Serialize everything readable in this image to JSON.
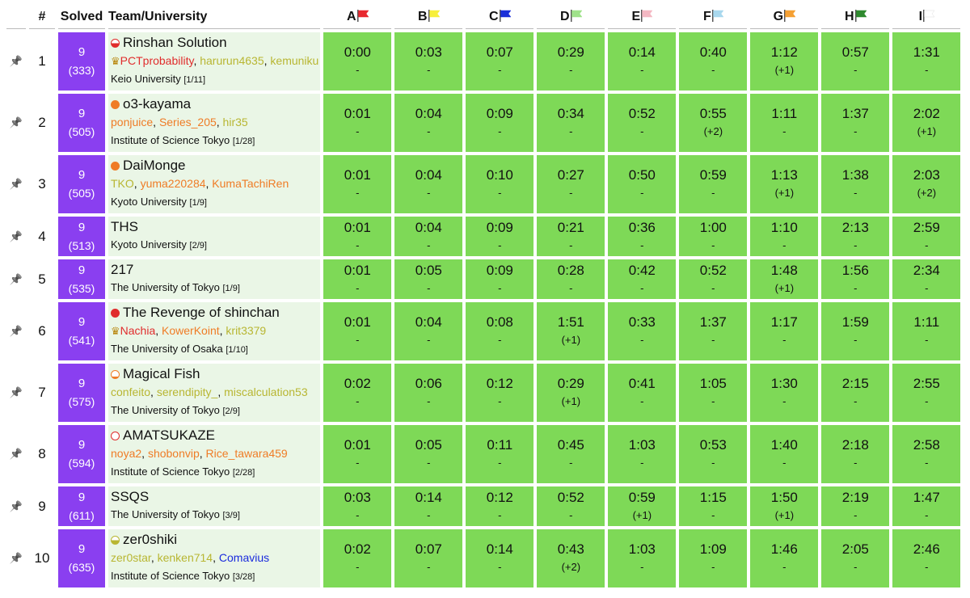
{
  "headers": {
    "rank": "#",
    "solved": "Solved",
    "team": "Team/University"
  },
  "problems": [
    {
      "letter": "A",
      "flag_color": "#e8292f"
    },
    {
      "letter": "B",
      "flag_color": "#f7ef3a"
    },
    {
      "letter": "C",
      "flag_color": "#1a2fd8"
    },
    {
      "letter": "D",
      "flag_color": "#9fe28a"
    },
    {
      "letter": "E",
      "flag_color": "#f4b8c3"
    },
    {
      "letter": "F",
      "flag_color": "#a9d8ee"
    },
    {
      "letter": "G",
      "flag_color": "#f5a033"
    },
    {
      "letter": "H",
      "flag_color": "#2f8a2f"
    },
    {
      "letter": "I",
      "flag_color": "#ffffff"
    }
  ],
  "colors": {
    "solved_bg": "#8a3ff0",
    "ac_bg": "#7ed957",
    "team_bg": "#eaf6e6",
    "red": "#e02c2c",
    "orange": "#ef7c26",
    "yellow": "#b8b632",
    "blue": "#1b2bdd"
  },
  "rows": [
    {
      "rank": "1",
      "solved": "9",
      "penalty": "(333)",
      "name": "Rinshan Solution",
      "dot": "red-half",
      "members": [
        {
          "name": "PCTprobability",
          "color": "#e02c2c",
          "crown": true
        },
        {
          "name": "harurun4635",
          "color": "#b8b632"
        },
        {
          "name": "kemuniku",
          "color": "#b8b632"
        }
      ],
      "university": "Keio University",
      "uni_rank": "[1/11]",
      "cells": [
        [
          "0:00",
          "-"
        ],
        [
          "0:03",
          "-"
        ],
        [
          "0:07",
          "-"
        ],
        [
          "0:29",
          "-"
        ],
        [
          "0:14",
          "-"
        ],
        [
          "0:40",
          "-"
        ],
        [
          "1:12",
          "(+1)"
        ],
        [
          "0:57",
          "-"
        ],
        [
          "1:31",
          "-"
        ]
      ]
    },
    {
      "rank": "2",
      "solved": "9",
      "penalty": "(505)",
      "name": "o3-kayama",
      "dot": "orange-full",
      "members": [
        {
          "name": "ponjuice",
          "color": "#ef7c26"
        },
        {
          "name": "Series_205",
          "color": "#ef7c26"
        },
        {
          "name": "hir35",
          "color": "#b8b632"
        }
      ],
      "university": "Institute of Science Tokyo",
      "uni_rank": "[1/28]",
      "cells": [
        [
          "0:01",
          "-"
        ],
        [
          "0:04",
          "-"
        ],
        [
          "0:09",
          "-"
        ],
        [
          "0:34",
          "-"
        ],
        [
          "0:52",
          "-"
        ],
        [
          "0:55",
          "(+2)"
        ],
        [
          "1:11",
          "-"
        ],
        [
          "1:37",
          "-"
        ],
        [
          "2:02",
          "(+1)"
        ]
      ]
    },
    {
      "rank": "3",
      "solved": "9",
      "penalty": "(505)",
      "name": "DaiMonge",
      "dot": "orange-full",
      "members": [
        {
          "name": "TKO",
          "color": "#b8b632"
        },
        {
          "name": "yuma220284",
          "color": "#ef7c26"
        },
        {
          "name": "KumaTachiRen",
          "color": "#ef7c26"
        }
      ],
      "university": "Kyoto University",
      "uni_rank": "[1/9]",
      "cells": [
        [
          "0:01",
          "-"
        ],
        [
          "0:04",
          "-"
        ],
        [
          "0:10",
          "-"
        ],
        [
          "0:27",
          "-"
        ],
        [
          "0:50",
          "-"
        ],
        [
          "0:59",
          "-"
        ],
        [
          "1:13",
          "(+1)"
        ],
        [
          "1:38",
          "-"
        ],
        [
          "2:03",
          "(+2)"
        ]
      ]
    },
    {
      "rank": "4",
      "solved": "9",
      "penalty": "(513)",
      "name": "THS",
      "dot": "",
      "members": [],
      "university": "Kyoto University",
      "uni_rank": "[2/9]",
      "cells": [
        [
          "0:01",
          "-"
        ],
        [
          "0:04",
          "-"
        ],
        [
          "0:09",
          "-"
        ],
        [
          "0:21",
          "-"
        ],
        [
          "0:36",
          "-"
        ],
        [
          "1:00",
          "-"
        ],
        [
          "1:10",
          "-"
        ],
        [
          "2:13",
          "-"
        ],
        [
          "2:59",
          "-"
        ]
      ]
    },
    {
      "rank": "5",
      "solved": "9",
      "penalty": "(535)",
      "name": "217",
      "dot": "",
      "members": [],
      "university": "The University of Tokyo",
      "uni_rank": "[1/9]",
      "cells": [
        [
          "0:01",
          "-"
        ],
        [
          "0:05",
          "-"
        ],
        [
          "0:09",
          "-"
        ],
        [
          "0:28",
          "-"
        ],
        [
          "0:42",
          "-"
        ],
        [
          "0:52",
          "-"
        ],
        [
          "1:48",
          "(+1)"
        ],
        [
          "1:56",
          "-"
        ],
        [
          "2:34",
          "-"
        ]
      ]
    },
    {
      "rank": "6",
      "solved": "9",
      "penalty": "(541)",
      "name": "The Revenge of shinchan",
      "dot": "red-full",
      "members": [
        {
          "name": "Nachia",
          "color": "#e02c2c",
          "crown": true
        },
        {
          "name": "KowerKoint",
          "color": "#ef7c26"
        },
        {
          "name": "krit3379",
          "color": "#b8b632"
        }
      ],
      "university": "The University of Osaka",
      "uni_rank": "[1/10]",
      "cells": [
        [
          "0:01",
          "-"
        ],
        [
          "0:04",
          "-"
        ],
        [
          "0:08",
          "-"
        ],
        [
          "1:51",
          "(+1)"
        ],
        [
          "0:33",
          "-"
        ],
        [
          "1:37",
          "-"
        ],
        [
          "1:17",
          "-"
        ],
        [
          "1:59",
          "-"
        ],
        [
          "1:11",
          "-"
        ]
      ]
    },
    {
      "rank": "7",
      "solved": "9",
      "penalty": "(575)",
      "name": "Magical Fish",
      "dot": "orange-low",
      "members": [
        {
          "name": "confeito",
          "color": "#b8b632"
        },
        {
          "name": "serendipity_",
          "color": "#b8b632"
        },
        {
          "name": "miscalculation53",
          "color": "#b8b632"
        }
      ],
      "university": "The University of Tokyo",
      "uni_rank": "[2/9]",
      "cells": [
        [
          "0:02",
          "-"
        ],
        [
          "0:06",
          "-"
        ],
        [
          "0:12",
          "-"
        ],
        [
          "0:29",
          "(+1)"
        ],
        [
          "0:41",
          "-"
        ],
        [
          "1:05",
          "-"
        ],
        [
          "1:30",
          "-"
        ],
        [
          "2:15",
          "-"
        ],
        [
          "2:55",
          "-"
        ]
      ]
    },
    {
      "rank": "8",
      "solved": "9",
      "penalty": "(594)",
      "name": "AMATSUKAZE",
      "dot": "red-empty",
      "members": [
        {
          "name": "noya2",
          "color": "#ef7c26"
        },
        {
          "name": "shobonvip",
          "color": "#ef7c26"
        },
        {
          "name": "Rice_tawara459",
          "color": "#ef7c26"
        }
      ],
      "university": "Institute of Science Tokyo",
      "uni_rank": "[2/28]",
      "cells": [
        [
          "0:01",
          "-"
        ],
        [
          "0:05",
          "-"
        ],
        [
          "0:11",
          "-"
        ],
        [
          "0:45",
          "-"
        ],
        [
          "1:03",
          "-"
        ],
        [
          "0:53",
          "-"
        ],
        [
          "1:40",
          "-"
        ],
        [
          "2:18",
          "-"
        ],
        [
          "2:58",
          "-"
        ]
      ]
    },
    {
      "rank": "9",
      "solved": "9",
      "penalty": "(611)",
      "name": "SSQS",
      "dot": "",
      "members": [],
      "university": "The University of Tokyo",
      "uni_rank": "[3/9]",
      "cells": [
        [
          "0:03",
          "-"
        ],
        [
          "0:14",
          "-"
        ],
        [
          "0:12",
          "-"
        ],
        [
          "0:52",
          "-"
        ],
        [
          "0:59",
          "(+1)"
        ],
        [
          "1:15",
          "-"
        ],
        [
          "1:50",
          "(+1)"
        ],
        [
          "2:19",
          "-"
        ],
        [
          "1:47",
          "-"
        ]
      ]
    },
    {
      "rank": "10",
      "solved": "9",
      "penalty": "(635)",
      "name": "zer0shiki",
      "dot": "yellow-half",
      "members": [
        {
          "name": "zer0star",
          "color": "#b8b632"
        },
        {
          "name": "kenken714",
          "color": "#b8b632"
        },
        {
          "name": "Comavius",
          "color": "#1b2bdd"
        }
      ],
      "university": "Institute of Science Tokyo",
      "uni_rank": "[3/28]",
      "cells": [
        [
          "0:02",
          "-"
        ],
        [
          "0:07",
          "-"
        ],
        [
          "0:14",
          "-"
        ],
        [
          "0:43",
          "(+2)"
        ],
        [
          "1:03",
          "-"
        ],
        [
          "1:09",
          "-"
        ],
        [
          "1:46",
          "-"
        ],
        [
          "2:05",
          "-"
        ],
        [
          "2:46",
          "-"
        ]
      ]
    }
  ]
}
